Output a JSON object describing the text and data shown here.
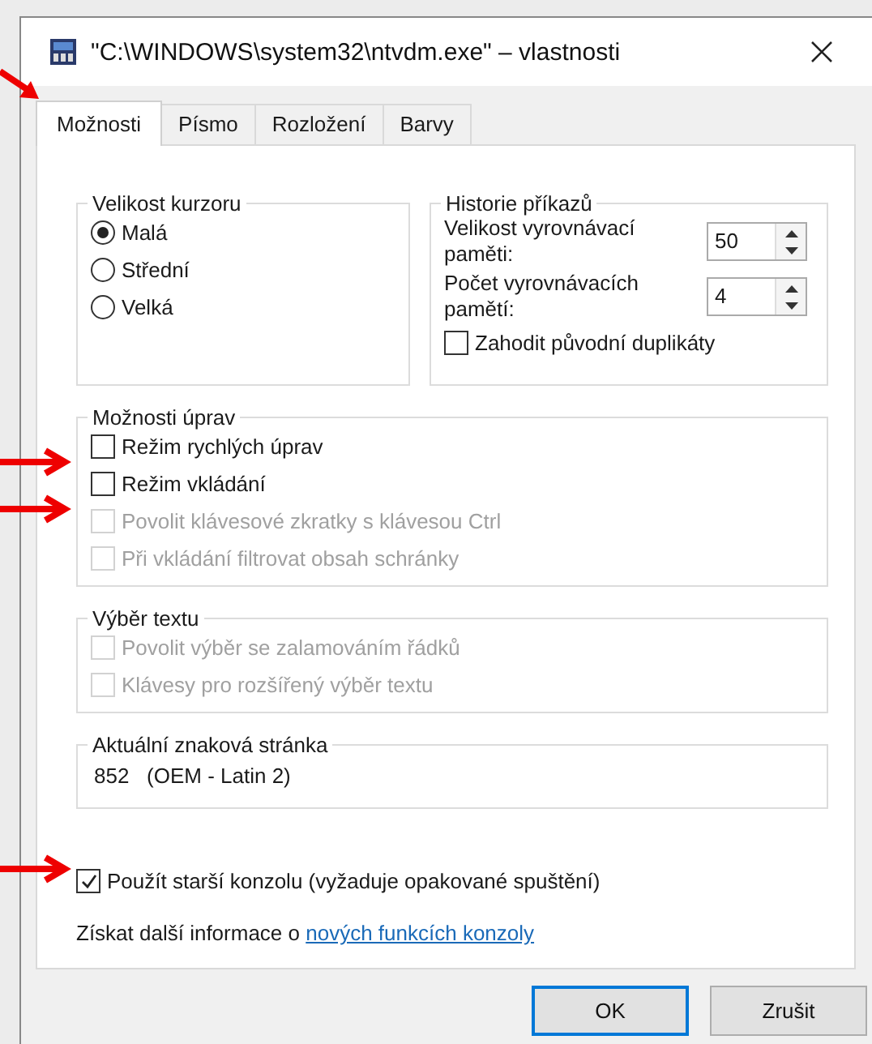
{
  "window": {
    "title": "\"C:\\WINDOWS\\system32\\ntvdm.exe\" – vlastnosti"
  },
  "tabs": [
    {
      "label": "Možnosti",
      "selected": true
    },
    {
      "label": "Písmo",
      "selected": false
    },
    {
      "label": "Rozložení",
      "selected": false
    },
    {
      "label": "Barvy",
      "selected": false
    }
  ],
  "cursor_size": {
    "title": "Velikost kurzoru",
    "options": [
      {
        "label": "Malá",
        "selected": true
      },
      {
        "label": "Střední",
        "selected": false
      },
      {
        "label": "Velká",
        "selected": false
      }
    ]
  },
  "command_history": {
    "title": "Historie příkazů",
    "fields": [
      {
        "label": "Velikost vyrovnávací paměti:",
        "value": "50"
      },
      {
        "label": "Počet vyrovnávacích pamětí:",
        "value": "4"
      }
    ],
    "discard_duplicates": {
      "label": "Zahodit původní duplikáty",
      "checked": false
    }
  },
  "edit_options": {
    "title": "Možnosti úprav",
    "items": [
      {
        "label": "Režim rychlých úprav",
        "checked": false,
        "disabled": false
      },
      {
        "label": "Režim vkládání",
        "checked": false,
        "disabled": false
      },
      {
        "label": "Povolit klávesové zkratky s klávesou Ctrl",
        "checked": false,
        "disabled": true
      },
      {
        "label": "Při vkládání filtrovat obsah schránky",
        "checked": false,
        "disabled": true
      }
    ]
  },
  "text_selection": {
    "title": "Výběr textu",
    "items": [
      {
        "label": "Povolit výběr se zalamováním řádků",
        "checked": false,
        "disabled": true
      },
      {
        "label": "Klávesy pro rozšířený výběr textu",
        "checked": false,
        "disabled": true
      }
    ]
  },
  "code_page": {
    "title": "Aktuální znaková stránka",
    "value": "852   (OEM - Latin 2)"
  },
  "legacy_console": {
    "label": "Použít starší konzolu (vyžaduje opakované spuštění)",
    "checked": true
  },
  "info": {
    "text": "Získat další informace o ",
    "link": "nových funkcích konzoly"
  },
  "buttons": [
    {
      "label": "OK",
      "default": true
    },
    {
      "label": "Zrušit",
      "default": false
    }
  ]
}
